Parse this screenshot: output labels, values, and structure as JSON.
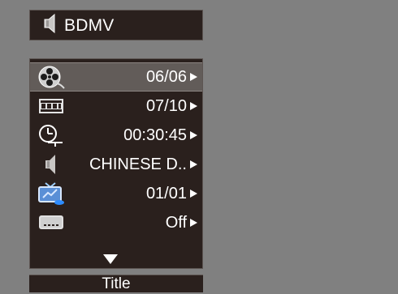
{
  "source": {
    "icon": "audio-speaker-icon",
    "label": "BDMV"
  },
  "menu": {
    "items": [
      {
        "icon": "film-reel-icon",
        "value": "06/06",
        "selected": true
      },
      {
        "icon": "film-strip-icon",
        "value": "07/10",
        "selected": false
      },
      {
        "icon": "clock-time-icon",
        "value": "00:30:45",
        "selected": false
      },
      {
        "icon": "audio-speaker-icon",
        "value": "CHINESE D..",
        "selected": false
      },
      {
        "icon": "tv-angle-icon",
        "value": "01/01",
        "selected": false
      },
      {
        "icon": "subtitle-icon",
        "value": "Off",
        "selected": false
      }
    ]
  },
  "footer": {
    "label": "Title"
  },
  "colors": {
    "background": "#808080",
    "panel": "#2a201d",
    "selection": "#625c59",
    "text": "#ffffff",
    "accent_blue": "#3a8fe1"
  }
}
